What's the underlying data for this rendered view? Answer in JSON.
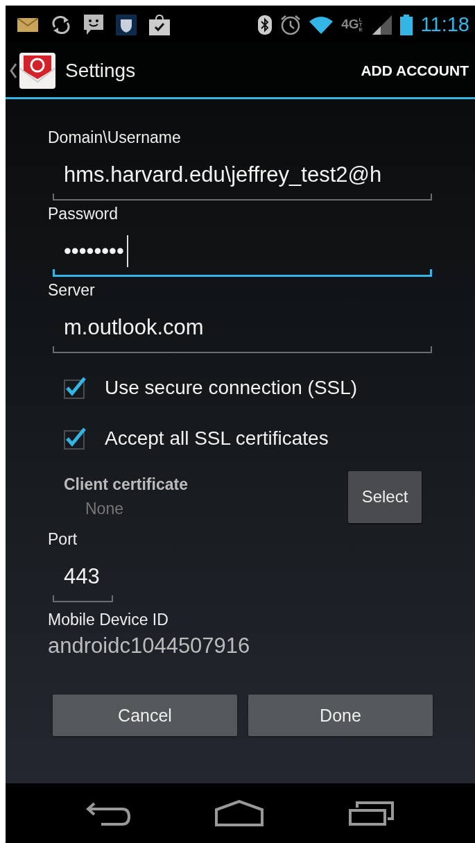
{
  "status_bar": {
    "network": "4G",
    "network_sub": "LTE",
    "time": "11:18"
  },
  "action_bar": {
    "title": "Settings",
    "action": "ADD ACCOUNT"
  },
  "fields": [
    {
      "label": "Domain\\Username",
      "value": "hms.harvard.edu\\jeffrey_test2@h",
      "kind": "wide",
      "focused": false
    },
    {
      "label": "Password",
      "value": "••••••••",
      "kind": "wide",
      "focused": true
    },
    {
      "label": "Server",
      "value": "m.outlook.com",
      "kind": "wide",
      "focused": false
    }
  ],
  "checkboxes": [
    {
      "label": "Use secure connection (SSL)",
      "checked": true
    },
    {
      "label": "Accept all SSL certificates",
      "checked": true
    }
  ],
  "client_certificate": {
    "label": "Client certificate",
    "value": "None",
    "button": "Select"
  },
  "port": {
    "label": "Port",
    "value": "443",
    "kind": "short",
    "focused": false
  },
  "device_id": {
    "label": "Mobile Device ID",
    "value": "androidc1044507916"
  },
  "buttons": [
    "Cancel",
    "Done"
  ]
}
